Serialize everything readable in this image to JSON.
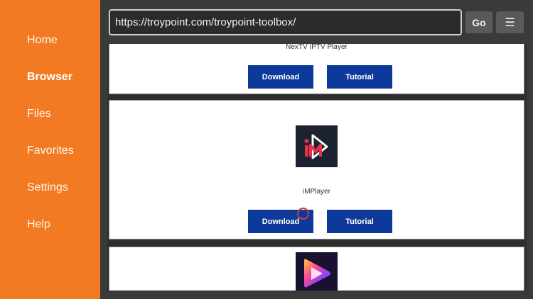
{
  "sidebar": {
    "items": [
      {
        "label": "Home"
      },
      {
        "label": "Browser",
        "active": true
      },
      {
        "label": "Files"
      },
      {
        "label": "Favorites"
      },
      {
        "label": "Settings"
      },
      {
        "label": "Help"
      }
    ]
  },
  "toolbar": {
    "url": "https://troypoint.com/troypoint-toolbox/",
    "go_label": "Go",
    "menu_label": "☰"
  },
  "page": {
    "cards": [
      {
        "name": "NexTV IPTV Player",
        "download_label": "Download",
        "tutorial_label": "Tutorial"
      },
      {
        "name": "iMPlayer",
        "download_label": "Download",
        "tutorial_label": "Tutorial",
        "icon": "implayer-logo-icon"
      },
      {
        "icon": "colorful-play-logo-icon"
      }
    ]
  },
  "colors": {
    "sidebar": "#f27a22",
    "button": "#0d3a9a",
    "background": "#3a3a3a"
  }
}
